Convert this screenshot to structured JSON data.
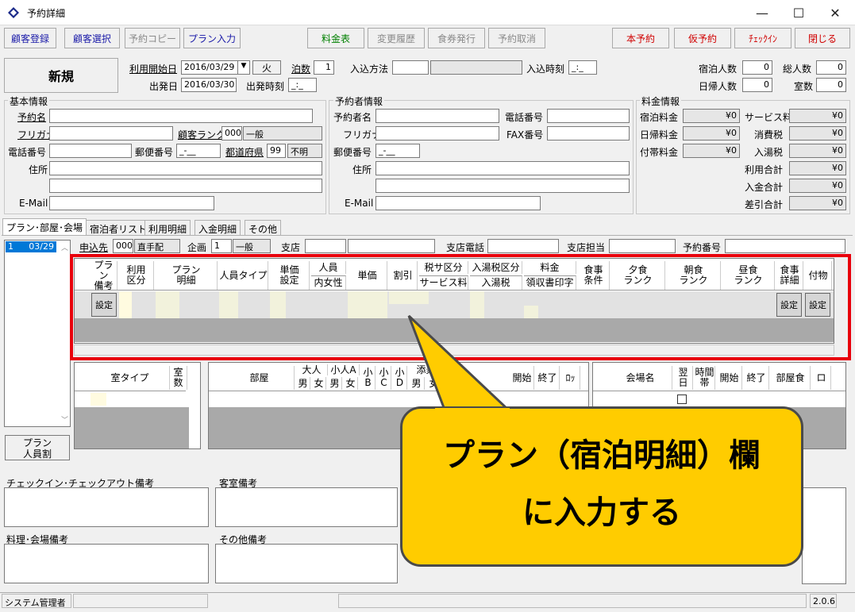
{
  "window": {
    "title": "予約詳細",
    "icon": "app-diamond-icon"
  },
  "toolbar": {
    "guest_register": "顧客登録",
    "guest_select": "顧客選択",
    "reservation_copy": "予約コピー",
    "plan_input": "プラン入力",
    "rate_table": "料金表",
    "change_history": "変更履歴",
    "meal_ticket": "食券発行",
    "cancel_reservation": "予約取消",
    "confirm_reservation": "本予約",
    "tentative_reservation": "仮予約",
    "check_in": "ﾁｪｯｸｲﾝ",
    "close": "閉じる"
  },
  "header": {
    "status": "新規",
    "start_date_label": "利用開始日",
    "start_date": "2016/03/29",
    "weekday": "火",
    "nights_label": "泊数",
    "nights": "1",
    "entry_method_label": "入込方法",
    "entry_time_label": "入込時刻",
    "entry_time": "_:_",
    "depart_date_label": "出発日",
    "depart_date": "2016/03/30",
    "depart_time_label": "出発時刻",
    "depart_time": "_:_",
    "stay_count_label": "宿泊人数",
    "stay_count": "0",
    "total_count_label": "総人数",
    "total_count": "0",
    "day_count_label": "日帰人数",
    "day_count": "0",
    "room_count_label": "室数",
    "room_count": "0"
  },
  "basic_info": {
    "title": "基本情報",
    "name_label": "予約名",
    "furigana_label": "フリガナ",
    "rank_label": "顧客ランク",
    "rank_code": "000",
    "rank_name": "一般",
    "phone_label": "電話番号",
    "postal_label": "郵便番号",
    "postal": "_-__",
    "pref_label": "都道府県",
    "pref_code": "99",
    "pref_name": "不明",
    "address_label": "住所",
    "email_label": "E-Mail"
  },
  "booker_info": {
    "title": "予約者情報",
    "name_label": "予約者名",
    "phone_label": "電話番号",
    "furigana_label": "フリガナ",
    "fax_label": "FAX番号",
    "postal_label": "郵便番号",
    "postal": "_-__",
    "address_label": "住所",
    "email_label": "E-Mail"
  },
  "fee_info": {
    "title": "料金情報",
    "stay_fee_label": "宿泊料金",
    "stay_fee": "¥0",
    "service_label": "サービス料",
    "service": "¥0",
    "day_fee_label": "日帰料金",
    "day_fee": "¥0",
    "tax_label": "消費税",
    "tax": "¥0",
    "extra_fee_label": "付帯料金",
    "extra_fee": "¥0",
    "bath_tax_label": "入湯税",
    "bath_tax": "¥0",
    "usage_total_label": "利用合計",
    "usage_total": "¥0",
    "deposit_total_label": "入金合計",
    "deposit_total": "¥0",
    "balance_label": "差引合計",
    "balance": "¥0"
  },
  "tabs": [
    "プラン･部屋･会場",
    "宿泊者リスト",
    "利用明細",
    "入金明細",
    "その他"
  ],
  "date_list": {
    "item_no": "1",
    "item_date": "03/29"
  },
  "plan_bar": {
    "applicant_label": "申込先",
    "applicant_code": "000",
    "applicant_name": "直手配",
    "project_label": "企画",
    "project_code": "1",
    "project_name": "一般",
    "branch_label": "支店",
    "branch_phone_label": "支店電話",
    "branch_staff_label": "支店担当",
    "reservation_no_label": "予約番号"
  },
  "plan_grid": {
    "headers": [
      "プラン\n備考",
      "利用\n区分",
      "プラン\n明細",
      "人員タイプ",
      "単価\n設定",
      "人員",
      "内女性",
      "単価",
      "割引",
      "税サ区分",
      "サービス料",
      "入湯税区分",
      "入湯税",
      "料金",
      "領収書印字",
      "食事\n条件",
      "夕食\nランク",
      "朝食\nランク",
      "昼食\nランク",
      "食事\n詳細",
      "付物"
    ],
    "set_button": "設定"
  },
  "room_grid": {
    "room_type": "室タイプ",
    "room_count": "室\n数"
  },
  "room_detail_grid": {
    "room": "部屋",
    "adult": "大人",
    "child_a": "小人A",
    "male": "男",
    "female": "女",
    "b": "小\nB",
    "c": "小\nC",
    "d": "小\nD",
    "attendant": "添乗",
    "start": "開始",
    "end": "終了",
    "lo": "ﾛｯ"
  },
  "venue_grid": {
    "venue_name": "会場名",
    "next_day": "翌\n日",
    "time_slot": "時間\n帯",
    "start": "開始",
    "end": "終了",
    "room_meal": "部屋食",
    "ro": "ロ"
  },
  "plan_people_button": "プラン\n人員割",
  "notes": {
    "checkin_checkout": "チェックイン･チェックアウト備考",
    "room": "客室備考",
    "cuisine_venue": "料理･会場備考",
    "other": "その他備考"
  },
  "status_bar": {
    "user": "システム管理者",
    "version": "2.0.6"
  },
  "callout": {
    "line1": "プラン（宿泊明細）欄",
    "line2": "に入力する"
  },
  "colors": {
    "highlight_border": "#e8000c",
    "callout_fill": "#ffcc00",
    "accent_blue": "#1a1aa8",
    "accent_red": "#d00000"
  }
}
